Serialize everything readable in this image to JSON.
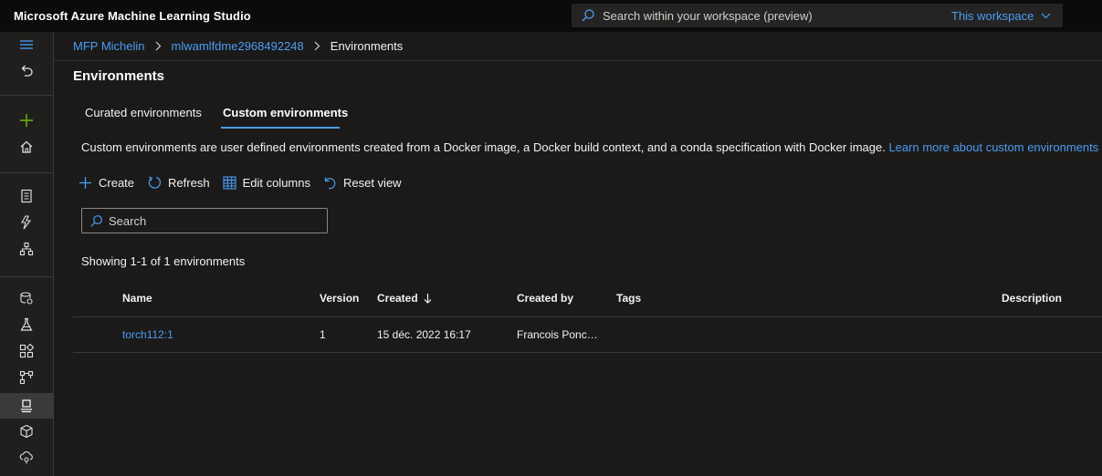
{
  "app": {
    "title": "Microsoft Azure Machine Learning Studio"
  },
  "global_search": {
    "placeholder": "Search within your workspace (preview)",
    "scope": "This workspace"
  },
  "breadcrumb": [
    {
      "label": "MFP Michelin"
    },
    {
      "label": "mlwamlfdme2968492248"
    },
    {
      "label": "Environments"
    }
  ],
  "page": {
    "title": "Environments",
    "tabs": [
      {
        "label": "Curated environments",
        "selected": false
      },
      {
        "label": "Custom environments",
        "selected": true
      }
    ],
    "description": "Custom environments are user defined environments created from a Docker image, a Docker build context, and a conda specification with Docker image.",
    "learn_more": "Learn more about custom environments"
  },
  "toolbar": {
    "create": "Create",
    "refresh": "Refresh",
    "edit_columns": "Edit columns",
    "reset_view": "Reset view"
  },
  "search": {
    "placeholder": "Search"
  },
  "showing": "Showing 1-1 of 1 environments",
  "table": {
    "columns": {
      "name": "Name",
      "version": "Version",
      "created": "Created",
      "created_by": "Created by",
      "tags": "Tags",
      "description": "Description"
    },
    "sort": {
      "column": "Created",
      "direction": "descending"
    },
    "rows": [
      {
        "name": "torch112:1",
        "version": "1",
        "created": "15 déc. 2022 16:17",
        "created_by": "Francois Ponch...",
        "tags": "",
        "description": ""
      }
    ]
  },
  "leftnav": {
    "icons": [
      "hamburger-icon",
      "back-icon",
      "add-icon",
      "home-icon",
      "notebook-icon",
      "automl-icon",
      "designer-icon",
      "data-icon",
      "jobs-icon",
      "components-icon",
      "pipelines-icon",
      "environments-icon",
      "models-icon",
      "endpoints-icon"
    ],
    "active": "environments-icon"
  },
  "colors": {
    "accent": "#479ef5",
    "add": "#6bb700",
    "background": "#1b1a19",
    "topbar": "#0b0b0b"
  }
}
